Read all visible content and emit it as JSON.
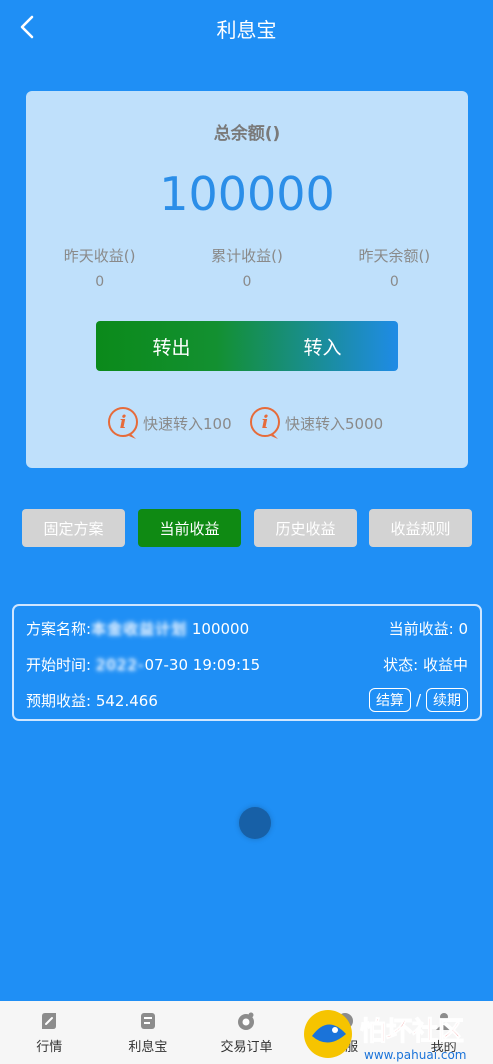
{
  "header": {
    "title": "利息宝"
  },
  "summary": {
    "total_label": "总余额()",
    "total_value": "100000",
    "stats": [
      {
        "label": "昨天收益()",
        "value": "0"
      },
      {
        "label": "累计收益()",
        "value": "0"
      },
      {
        "label": "昨天余额()",
        "value": "0"
      }
    ],
    "transfer_out": "转出",
    "transfer_in": "转入",
    "quick": [
      "快速转入100",
      "快速转入5000"
    ]
  },
  "tabs": [
    {
      "label": "固定方案"
    },
    {
      "label": "当前收益"
    },
    {
      "label": "历史收益"
    },
    {
      "label": "收益规则"
    }
  ],
  "plan": {
    "name_label": "方案名称:",
    "name_obscured": "本金收益计划",
    "amount": "100000",
    "current_income_label": "当前收益:",
    "current_income_value": "0",
    "start_time_label": "开始时间:",
    "start_time_obscured": "2022-",
    "start_time_value": "07-30 19:09:15",
    "status_label": "状态:",
    "status_value": "收益中",
    "expected_label": "预期收益:",
    "expected_value": "542.466",
    "settle_button": "结算",
    "separator": "/",
    "renew_button": "续期"
  },
  "nav": [
    {
      "label": "行情",
      "icon": "market-icon"
    },
    {
      "label": "利息宝",
      "icon": "interest-icon"
    },
    {
      "label": "交易订单",
      "icon": "orders-icon"
    },
    {
      "label": "客服",
      "icon": "service-icon"
    },
    {
      "label": "我的",
      "icon": "profile-icon"
    }
  ],
  "watermark": {
    "text": "怕坏社区",
    "url": "www.pahuai.com"
  },
  "colors": {
    "primary": "#1f8ff5",
    "active_tab": "#0f8a13",
    "card": "#bfe0fb",
    "accent_text": "#2b8ee8",
    "info_icon": "#e66b3a"
  }
}
